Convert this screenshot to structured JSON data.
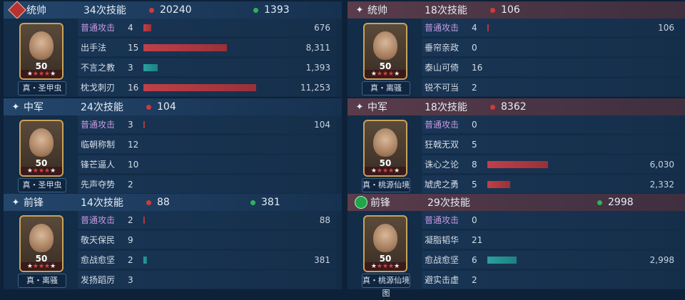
{
  "panels": [
    {
      "side": "left",
      "position_label": "统帅",
      "position_icon": "red-diamond-badge-icon",
      "skill_count": "34次技能",
      "damage": "20240",
      "heal": "1393",
      "hero_level": "50",
      "tactic": "真・圣甲虫",
      "skills": [
        {
          "name": "普通攻击",
          "count": "4",
          "value": "676",
          "bar_fraction": 0.06,
          "bar_color": "red",
          "basic": true
        },
        {
          "name": "出手法",
          "count": "15",
          "value": "8,311",
          "bar_fraction": 0.65,
          "bar_color": "red",
          "basic": false
        },
        {
          "name": "不言之教",
          "count": "3",
          "value": "1,393",
          "bar_fraction": 0.11,
          "bar_color": "teal",
          "basic": false
        },
        {
          "name": "枕戈刺刃",
          "count": "16",
          "value": "11,253",
          "bar_fraction": 0.88,
          "bar_color": "red",
          "basic": false
        }
      ]
    },
    {
      "side": "left",
      "position_label": "中军",
      "position_icon": "sparkle-icon",
      "skill_count": "24次技能",
      "damage": "104",
      "heal": "",
      "hero_level": "50",
      "tactic": "真・圣甲虫",
      "skills": [
        {
          "name": "普通攻击",
          "count": "3",
          "value": "104",
          "bar_fraction": 0.01,
          "bar_color": "red",
          "basic": true
        },
        {
          "name": "临朝称制",
          "count": "12",
          "value": "",
          "bar_fraction": 0,
          "bar_color": "red",
          "basic": false
        },
        {
          "name": "锋芒逼人",
          "count": "10",
          "value": "",
          "bar_fraction": 0,
          "bar_color": "red",
          "basic": false
        },
        {
          "name": "先声夺势",
          "count": "2",
          "value": "",
          "bar_fraction": 0,
          "bar_color": "red",
          "basic": false
        }
      ]
    },
    {
      "side": "left",
      "position_label": "前锋",
      "position_icon": "sparkle-icon",
      "skill_count": "14次技能",
      "damage": "88",
      "heal": "381",
      "hero_level": "50",
      "tactic": "真・离骚",
      "skills": [
        {
          "name": "普通攻击",
          "count": "2",
          "value": "88",
          "bar_fraction": 0.01,
          "bar_color": "red",
          "basic": true
        },
        {
          "name": "敬天保民",
          "count": "9",
          "value": "",
          "bar_fraction": 0,
          "bar_color": "red",
          "basic": false
        },
        {
          "name": "愈战愈坚",
          "count": "2",
          "value": "381",
          "bar_fraction": 0.03,
          "bar_color": "teal",
          "basic": false
        },
        {
          "name": "发扬蹈厉",
          "count": "3",
          "value": "",
          "bar_fraction": 0,
          "bar_color": "red",
          "basic": false
        }
      ]
    },
    {
      "side": "right",
      "position_label": "统帅",
      "position_icon": "sparkle-icon",
      "skill_count": "18次技能",
      "damage": "106",
      "heal": "",
      "hero_level": "50",
      "tactic": "真・离骚",
      "skills": [
        {
          "name": "普通攻击",
          "count": "4",
          "value": "106",
          "bar_fraction": 0.01,
          "bar_color": "red",
          "basic": true
        },
        {
          "name": "垂帘亲政",
          "count": "0",
          "value": "",
          "bar_fraction": 0,
          "bar_color": "red",
          "basic": false
        },
        {
          "name": "泰山可倚",
          "count": "16",
          "value": "",
          "bar_fraction": 0,
          "bar_color": "red",
          "basic": false
        },
        {
          "name": "锐不可当",
          "count": "2",
          "value": "",
          "bar_fraction": 0,
          "bar_color": "red",
          "basic": false
        }
      ]
    },
    {
      "side": "right",
      "position_label": "中军",
      "position_icon": "sparkle-icon",
      "skill_count": "18次技能",
      "damage": "8362",
      "heal": "",
      "hero_level": "50",
      "tactic": "真・桃源仙境图",
      "skills": [
        {
          "name": "普通攻击",
          "count": "0",
          "value": "",
          "bar_fraction": 0,
          "bar_color": "red",
          "basic": true
        },
        {
          "name": "狂戟无双",
          "count": "5",
          "value": "",
          "bar_fraction": 0,
          "bar_color": "red",
          "basic": false
        },
        {
          "name": "诛心之论",
          "count": "8",
          "value": "6,030",
          "bar_fraction": 0.47,
          "bar_color": "red",
          "basic": false
        },
        {
          "name": "虓虎之勇",
          "count": "5",
          "value": "2,332",
          "bar_fraction": 0.18,
          "bar_color": "red",
          "basic": false
        }
      ]
    },
    {
      "side": "right",
      "position_label": "前锋",
      "position_icon": "green-heart-badge-icon",
      "skill_count": "29次技能",
      "damage": "",
      "heal": "2998",
      "hero_level": "50",
      "tactic": "真・桃源仙境图",
      "skills": [
        {
          "name": "普通攻击",
          "count": "0",
          "value": "",
          "bar_fraction": 0,
          "bar_color": "red",
          "basic": true
        },
        {
          "name": "凝脂韬华",
          "count": "21",
          "value": "",
          "bar_fraction": 0,
          "bar_color": "red",
          "basic": false
        },
        {
          "name": "愈战愈坚",
          "count": "6",
          "value": "2,998",
          "bar_fraction": 0.23,
          "bar_color": "teal",
          "basic": false
        },
        {
          "name": "避实击虚",
          "count": "2",
          "value": "",
          "bar_fraction": 0,
          "bar_color": "red",
          "basic": false
        }
      ]
    }
  ]
}
